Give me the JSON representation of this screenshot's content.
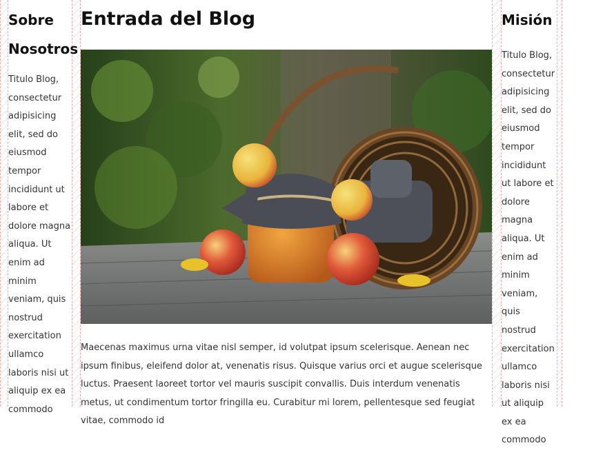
{
  "left": {
    "title": "Sobre Nosotros",
    "text": "Titulo Blog, consectetur adipisicing elit, sed do eiusmod tempor incididunt ut labore et dolore magna aliqua. Ut enim ad minim veniam, quis nostrud exercitation ullamco laboris nisi ut aliquip ex ea commodo"
  },
  "main": {
    "title": "Entrada del Blog",
    "image": "apples-jam-basket-photo",
    "text": "Maecenas maximus urna vitae nisl semper, id volutpat ipsum scelerisque. Aenean nec ipsum finibus, eleifend dolor at, venenatis risus. Quisque varius orci et augue scelerisque luctus. Praesent laoreet tortor vel mauris suscipit convallis. Duis interdum venenatis metus, ut condimentum tortor fringilla eu. Curabitur mi lorem, pellentesque sed feugiat vitae, commodo id"
  },
  "right": {
    "title": "Misión",
    "text": "Titulo Blog, consectetur adipisicing elit, sed do eiusmod tempor incididunt ut labore et dolore magna aliqua. Ut enim ad minim veniam, quis nostrud exercitation ullamco laboris nisi ut aliquip ex ea commodo"
  }
}
